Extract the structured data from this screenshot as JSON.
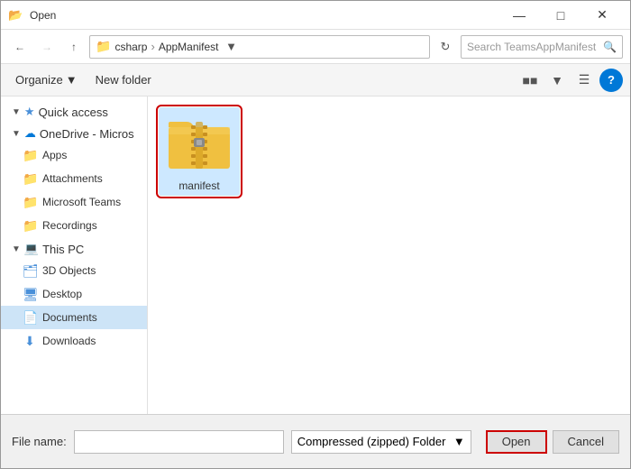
{
  "window": {
    "title": "Open",
    "title_icon": "📁"
  },
  "title_bar_controls": {
    "minimize": "—",
    "maximize": "□",
    "close": "✕"
  },
  "address_bar": {
    "back_tooltip": "Back",
    "forward_tooltip": "Forward",
    "up_tooltip": "Up",
    "path_icon": "📁",
    "breadcrumb": [
      "csharp",
      "AppManifest"
    ],
    "refresh_tooltip": "Refresh",
    "search_placeholder": "Search TeamsAppManifest"
  },
  "toolbar": {
    "organize_label": "Organize",
    "new_folder_label": "New folder",
    "view_label": "View"
  },
  "sidebar": {
    "quick_access": {
      "label": "Quick access",
      "icon": "⭐"
    },
    "onedrive": {
      "label": "OneDrive - Micros",
      "icon": "☁"
    },
    "onedrive_items": [
      {
        "label": "Apps",
        "icon": "📁",
        "color": "#dcb85e"
      },
      {
        "label": "Attachments",
        "icon": "📁",
        "color": "#dcb85e"
      },
      {
        "label": "Microsoft Teams",
        "icon": "📁",
        "color": "#dcb85e"
      },
      {
        "label": "Recordings",
        "icon": "📁",
        "color": "#dcb85e"
      }
    ],
    "this_pc": {
      "label": "This PC",
      "icon": "💻"
    },
    "this_pc_items": [
      {
        "label": "3D Objects",
        "icon": "🗂",
        "color": "#4a90d9"
      },
      {
        "label": "Desktop",
        "icon": "🖥",
        "color": "#4a90d9"
      },
      {
        "label": "Documents",
        "icon": "📄",
        "color": "#4a90d9",
        "active": true
      },
      {
        "label": "Downloads",
        "icon": "⬇",
        "color": "#4a90d9"
      }
    ]
  },
  "content": {
    "files": [
      {
        "name": "manifest",
        "type": "zip-folder"
      }
    ]
  },
  "bottom": {
    "filename_label": "File name:",
    "filename_value": "",
    "file_type": "Compressed (zipped) Folder",
    "open_label": "Open",
    "cancel_label": "Cancel"
  }
}
